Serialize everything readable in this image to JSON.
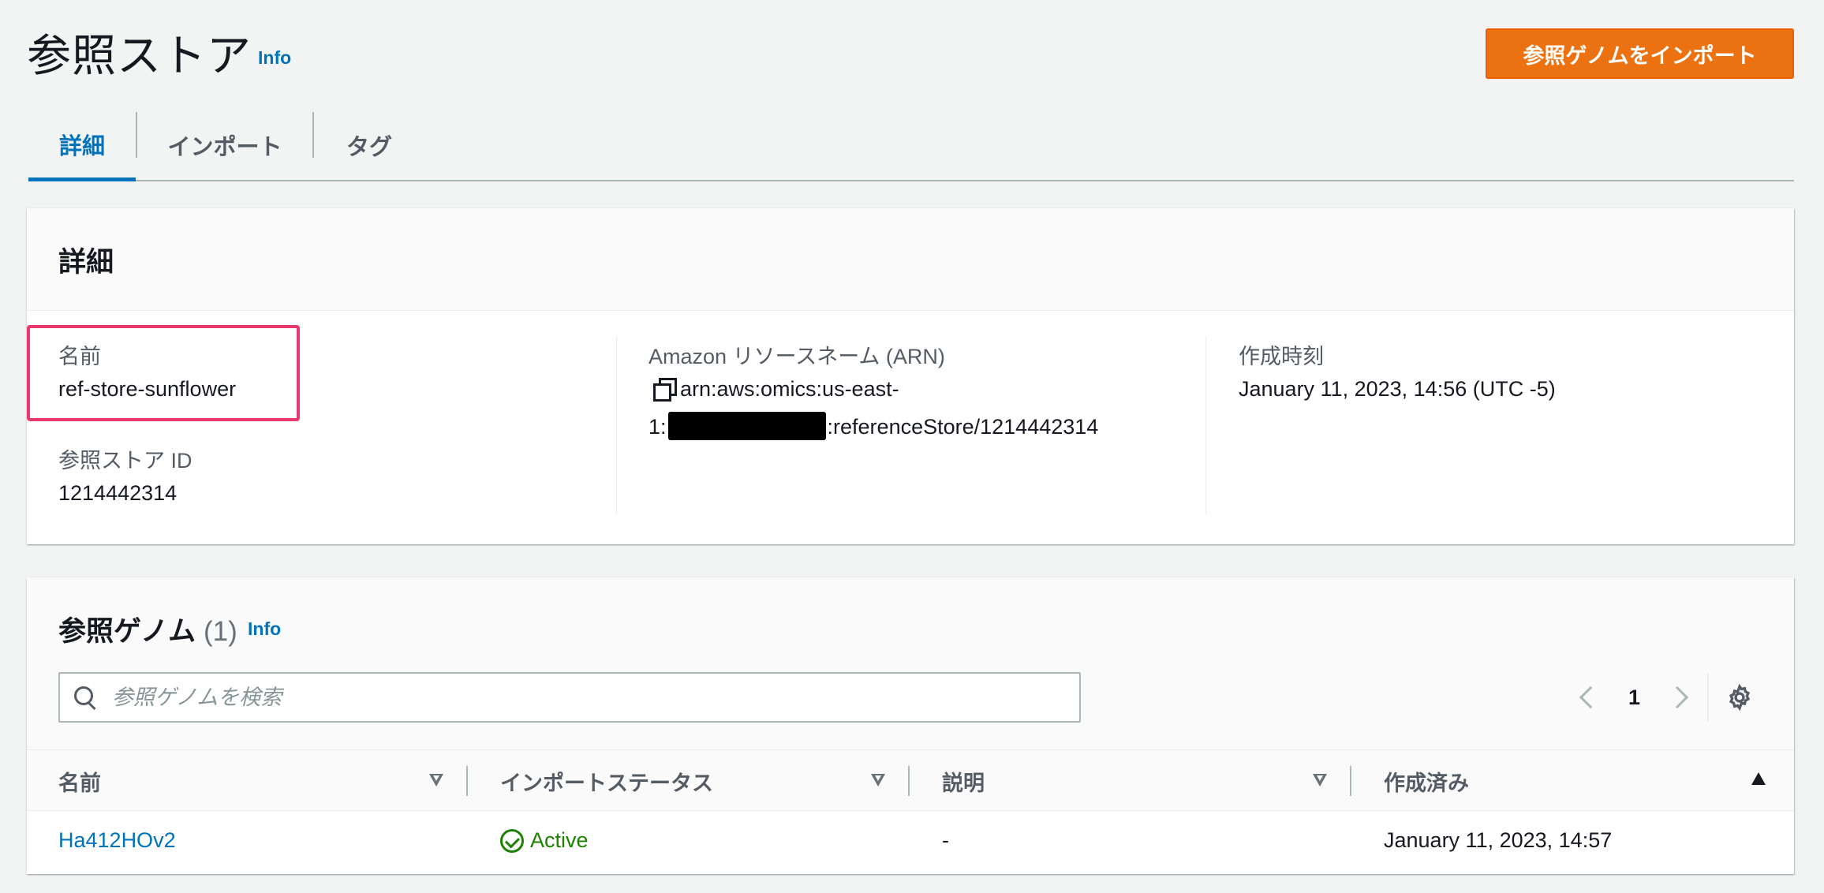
{
  "header": {
    "title": "参照ストア",
    "info_label": "Info",
    "primary_action": "参照ゲノムをインポート"
  },
  "tabs": [
    {
      "label": "詳細",
      "active": true
    },
    {
      "label": "インポート",
      "active": false
    },
    {
      "label": "タグ",
      "active": false
    }
  ],
  "details": {
    "heading": "詳細",
    "name_label": "名前",
    "name_value": "ref-store-sunflower",
    "id_label": "参照ストア ID",
    "id_value": "1214442314",
    "arn_label": "Amazon リソースネーム (ARN)",
    "arn_line1": "arn:aws:omics:us-east-",
    "arn_line2_prefix": "1:",
    "arn_line2_suffix": ":referenceStore/1214442314",
    "created_label": "作成時刻",
    "created_value": "January 11, 2023, 14:56 (UTC -5)"
  },
  "genomes": {
    "heading": "参照ゲノム",
    "count": "(1)",
    "info_label": "Info",
    "search_placeholder": "参照ゲノムを検索",
    "page_number": "1",
    "columns": [
      "名前",
      "インポートステータス",
      "説明",
      "作成済み"
    ],
    "rows": [
      {
        "name": "Ha412HOv2",
        "status": "Active",
        "description": "-",
        "created": "January 11, 2023, 14:57"
      }
    ]
  },
  "colors": {
    "primary_button": "#ec7211",
    "link": "#0073bb",
    "status_active": "#1d8102",
    "highlight": "#e8386d"
  },
  "icons": [
    "copy-icon",
    "search-icon",
    "chevron-left-icon",
    "chevron-right-icon",
    "gear-icon",
    "check-circle-icon",
    "sort-icon"
  ]
}
